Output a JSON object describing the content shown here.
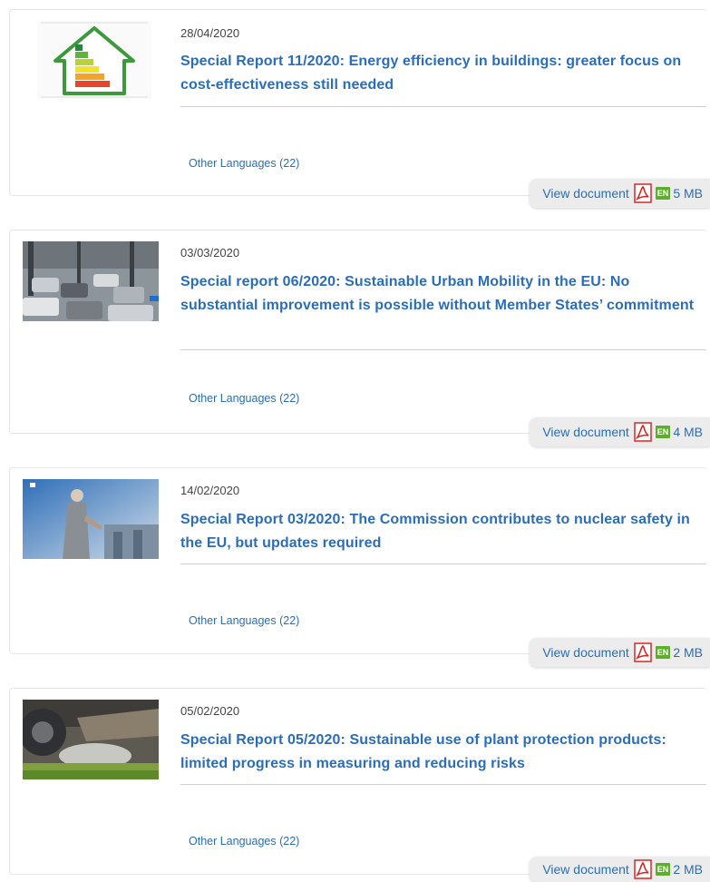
{
  "documents": [
    {
      "date": "28/04/2020",
      "title": "Special Report 11/2020: Energy efficiency in buildings: greater focus on cost-effectiveness still needed",
      "other_languages": "Other Languages (22)",
      "view_label": "View document",
      "lang_badge": "EN",
      "size": "5 MB",
      "thumb_icon": "energy-house-icon"
    },
    {
      "date": "03/03/2020",
      "title": "Special report 06/2020: Sustainable Urban Mobility in the EU: No substantial improvement is possible without Member States’ commitment",
      "other_languages": "Other Languages (22)",
      "view_label": "View document",
      "lang_badge": "EN",
      "size": "4 MB",
      "thumb_icon": "traffic-photo"
    },
    {
      "date": "14/02/2020",
      "title": "Special Report 03/2020: The Commission contributes to nuclear safety in the EU, but updates required",
      "other_languages": "Other Languages (22)",
      "view_label": "View document",
      "lang_badge": "EN",
      "size": "2 MB",
      "thumb_icon": "nuclear-plant-photo"
    },
    {
      "date": "05/02/2020",
      "title": "Special Report 05/2020: Sustainable use of plant protection products: limited progress in measuring and reducing risks",
      "other_languages": "Other Languages (22)",
      "view_label": "View document",
      "lang_badge": "EN",
      "size": "2 MB",
      "thumb_icon": "crop-spraying-photo"
    }
  ],
  "colors": {
    "link": "#2a6ebb",
    "badge_green": "#5dae2a",
    "pdf_red": "#d62828"
  }
}
